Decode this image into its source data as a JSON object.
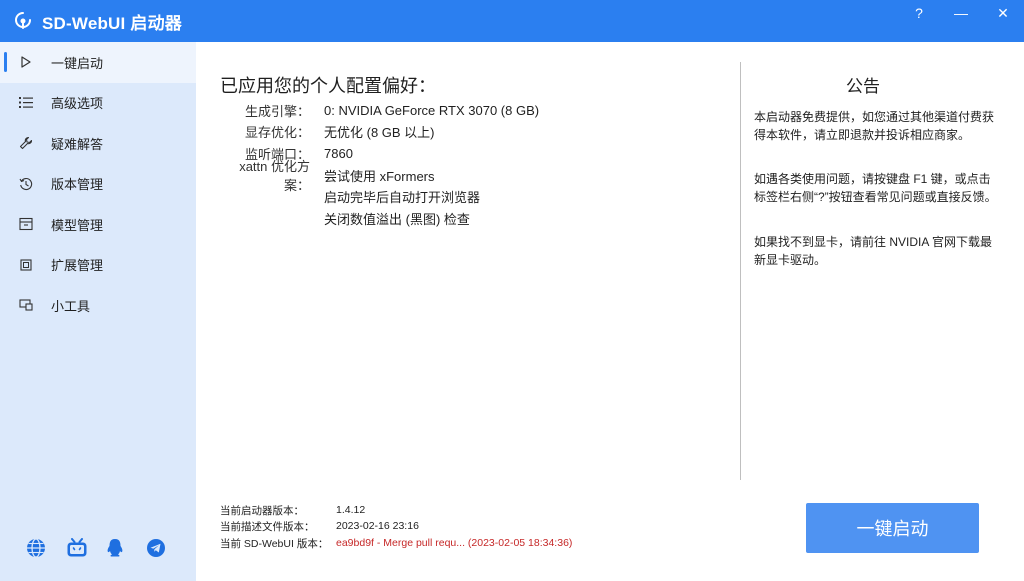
{
  "window": {
    "title": "SD-WebUI 启动器",
    "help_label": "?",
    "minimize_label": "—",
    "close_label": "✕",
    "accent": "#2b7ff0"
  },
  "sidebar": {
    "items": [
      {
        "label": "一键启动",
        "icon": "play-icon",
        "active": true
      },
      {
        "label": "高级选项",
        "icon": "list-icon"
      },
      {
        "label": "疑难解答",
        "icon": "wrench-icon"
      },
      {
        "label": "版本管理",
        "icon": "history-icon"
      },
      {
        "label": "模型管理",
        "icon": "cabinet-icon"
      },
      {
        "label": "扩展管理",
        "icon": "chip-icon"
      },
      {
        "label": "小工具",
        "icon": "tools-icon"
      }
    ],
    "footer_icons": [
      "globe-icon",
      "bilibili-icon",
      "qq-icon",
      "telegram-icon"
    ]
  },
  "main": {
    "heading": "已应用您的个人配置偏好：",
    "config": [
      {
        "label": "生成引擎：",
        "value": "0: NVIDIA GeForce RTX 3070 (8 GB)"
      },
      {
        "label": "显存优化：",
        "value": "无优化 (8 GB 以上)"
      },
      {
        "label": "监听端口：",
        "value": "7860"
      },
      {
        "label": "xattn 优化方案：",
        "value": "尝试使用 xFormers"
      },
      {
        "label": "",
        "value": "启动完毕后自动打开浏览器"
      },
      {
        "label": "",
        "value": "关闭数值溢出 (黑图) 检查"
      }
    ],
    "notice": {
      "title": "公告",
      "paragraphs": [
        "本启动器免费提供，如您通过其他渠道付费获得本软件，请立即退款并投诉相应商家。",
        "如遇各类使用问题，请按键盘 F1 键，或点击标签栏右侧“?”按钮查看常见问题或直接反馈。",
        "如果找不到显卡，请前往 NVIDIA 官网下载最新显卡驱动。"
      ]
    },
    "versions": [
      {
        "label": "当前启动器版本：",
        "value": "1.4.12"
      },
      {
        "label": "当前描述文件版本：",
        "value": "2023-02-16 23:16"
      },
      {
        "label": "当前 SD-WebUI 版本：",
        "value": "ea9bd9f - Merge pull requ... (2023-02-05 18:34:36)",
        "color": "#c62828"
      }
    ],
    "launch_button": "一键启动"
  }
}
